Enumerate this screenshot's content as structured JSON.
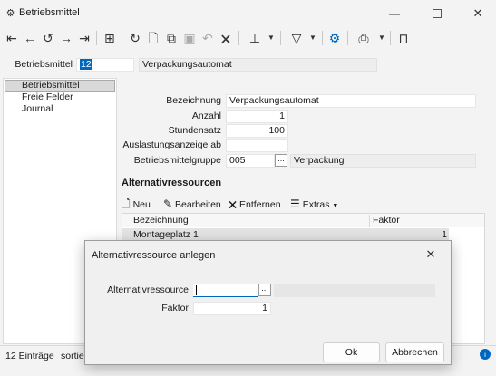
{
  "window": {
    "title": "Betriebsmittel",
    "app_icon": "gears-icon"
  },
  "toolbar": {
    "icons": [
      "first-icon",
      "prev-icon",
      "history-icon",
      "next-icon",
      "last-icon",
      "table-icon",
      "refresh-icon",
      "new-doc-icon",
      "copy-icon",
      "save-icon",
      "undo-icon",
      "delete-icon",
      "pin-icon",
      "filter-icon",
      "settings-icon",
      "print-icon",
      "layout-icon"
    ]
  },
  "header": {
    "label": "Betriebsmittel",
    "id": "12",
    "name": "Verpackungsautomat"
  },
  "sidebar": {
    "items": [
      {
        "label": "Betriebsmittel",
        "selected": true
      },
      {
        "label": "Freie Felder"
      },
      {
        "label": "Journal"
      }
    ]
  },
  "form": {
    "bezeichnung_label": "Bezeichnung",
    "bezeichnung": "Verpackungsautomat",
    "anzahl_label": "Anzahl",
    "anzahl": "1",
    "stundensatz_label": "Stundensatz",
    "stundensatz": "100",
    "auslastung_label": "Auslastungsanzeige ab",
    "auslastung": "",
    "gruppe_label": "Betriebsmittelgruppe",
    "gruppe_code": "005",
    "gruppe_name": "Verpackung",
    "dots": "..."
  },
  "alt": {
    "title": "Alternativressourcen",
    "toolbar": {
      "neu": "Neu",
      "bearbeiten": "Bearbeiten",
      "entfernen": "Entfernen",
      "extras": "Extras"
    },
    "columns": [
      "Bezeichnung",
      "Faktor"
    ],
    "rows": [
      {
        "bezeichnung": "Montageplatz 1",
        "faktor": "1"
      }
    ]
  },
  "statusbar": {
    "count": "12 Einträge",
    "sort": "sortiert"
  },
  "dialog": {
    "title": "Alternativressource anlegen",
    "ressource_label": "Alternativressource",
    "ressource_value": "",
    "faktor_label": "Faktor",
    "faktor_value": "1",
    "dots": "...",
    "ok": "Ok",
    "cancel": "Abbrechen"
  },
  "colors": {
    "accent": "#0067c0",
    "selected": "#d9d9d9"
  }
}
